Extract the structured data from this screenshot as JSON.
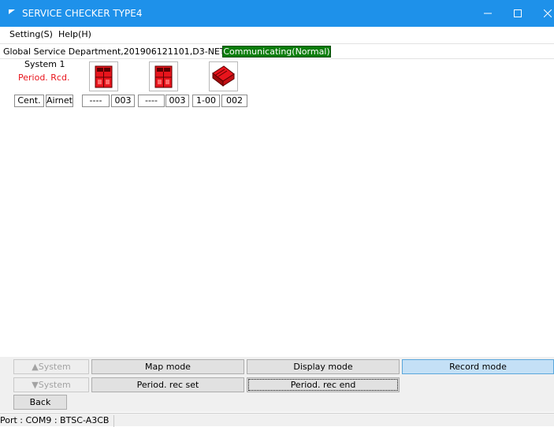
{
  "window": {
    "title": "SERVICE CHECKER TYPE4",
    "min_glyph": "—",
    "max_glyph": "☐",
    "close_glyph": "✕"
  },
  "menu": {
    "setting": "Setting(S)",
    "help": "Help(H)"
  },
  "header": {
    "department": "Global Service Department,201906121101,D3-NET",
    "comm_status": "Communicating(Normal)"
  },
  "system": {
    "name": "System 1",
    "mode_label": "Period. Rcd.",
    "mode_color": "#e8141c"
  },
  "units": [
    {
      "icon": "outdoor-unit-icon"
    },
    {
      "icon": "outdoor-unit-icon"
    },
    {
      "icon": "indoor-unit-icon"
    }
  ],
  "cells": {
    "cent": "Cent.",
    "airnet": "Airnet",
    "c1": "----",
    "c2": "003",
    "c3": "----",
    "c4": "003",
    "c5": "1-00",
    "c6": "002"
  },
  "buttons": {
    "system_up": "▲System",
    "system_down": "▼System",
    "map_mode": "Map mode",
    "display_mode": "Display mode",
    "record_mode": "Record mode",
    "period_rec_set": "Period. rec set",
    "period_rec_end": "Period. rec end",
    "back": "Back"
  },
  "status": {
    "port": "Port : COM9 : BTSC-A3CB"
  },
  "colors": {
    "titlebar": "#1e91ea",
    "comm_bg": "#0b7d0b",
    "unit_red": "#e8141c",
    "active_mode": "#c4e0f6"
  }
}
